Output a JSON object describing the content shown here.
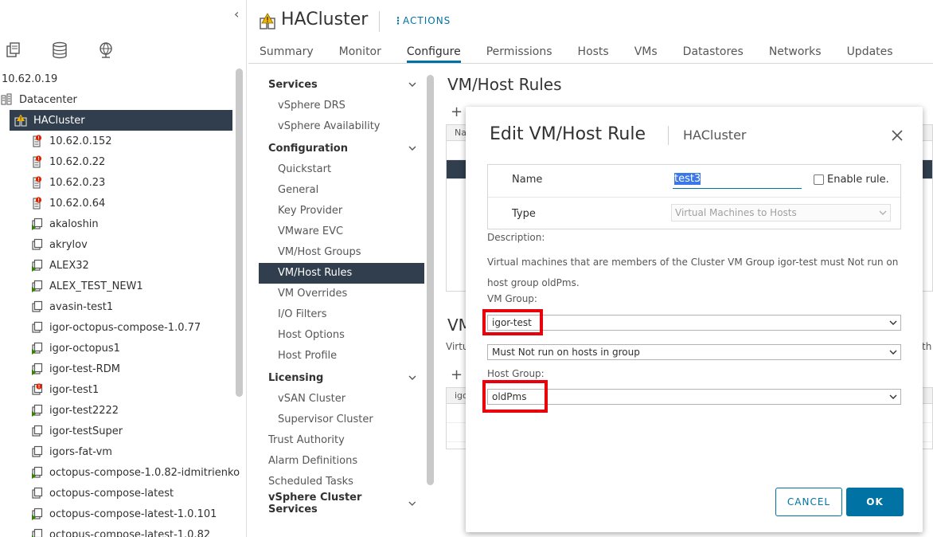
{
  "left_panel": {
    "collapse_glyph": "‹",
    "tab_icons": [
      "hosts-clusters-icon",
      "storage-icon",
      "network-icon"
    ],
    "tree": [
      {
        "label": "10.62.0.19",
        "icon": "none",
        "indent": 0
      },
      {
        "label": "Datacenter",
        "icon": "datacenter-icon",
        "indent": 0
      },
      {
        "label": "HACluster",
        "icon": "cluster-warning-icon",
        "indent": 1,
        "selected": true
      },
      {
        "label": "10.62.0.152",
        "icon": "host-alert-icon",
        "indent": 2
      },
      {
        "label": "10.62.0.22",
        "icon": "host-alert-icon",
        "indent": 2
      },
      {
        "label": "10.62.0.23",
        "icon": "host-alert-icon",
        "indent": 2
      },
      {
        "label": "10.62.0.64",
        "icon": "host-alert-icon",
        "indent": 2
      },
      {
        "label": "akaloshin",
        "icon": "vm-on-icon",
        "indent": 2
      },
      {
        "label": "akrylov",
        "icon": "vm-icon",
        "indent": 2
      },
      {
        "label": "ALEX32",
        "icon": "vm-on-icon",
        "indent": 2
      },
      {
        "label": "ALEX_TEST_NEW1",
        "icon": "vm-on-icon",
        "indent": 2
      },
      {
        "label": "avasin-test1",
        "icon": "vm-icon",
        "indent": 2
      },
      {
        "label": "igor-octopus-compose-1.0.77",
        "icon": "vm-icon",
        "indent": 2
      },
      {
        "label": "igor-octopus1",
        "icon": "vm-on-icon",
        "indent": 2
      },
      {
        "label": "igor-test-RDM",
        "icon": "vm-on-icon",
        "indent": 2
      },
      {
        "label": "igor-test1",
        "icon": "vm-alert-icon",
        "indent": 2
      },
      {
        "label": "igor-test2222",
        "icon": "vm-on-icon",
        "indent": 2
      },
      {
        "label": "igor-testSuper",
        "icon": "vm-icon",
        "indent": 2
      },
      {
        "label": "igors-fat-vm",
        "icon": "vm-icon",
        "indent": 2
      },
      {
        "label": "octopus-compose-1.0.82-idmitrienko",
        "icon": "vm-on-icon",
        "indent": 2
      },
      {
        "label": "octopus-compose-latest",
        "icon": "vm-icon",
        "indent": 2
      },
      {
        "label": "octopus-compose-latest-1.0.101",
        "icon": "vm-on-icon",
        "indent": 2
      },
      {
        "label": "octopus-compose-latest-1.0.82",
        "icon": "vm-on-icon",
        "indent": 2
      }
    ]
  },
  "header": {
    "title": "HACluster",
    "actions_label": "ACTIONS",
    "tabs": [
      "Summary",
      "Monitor",
      "Configure",
      "Permissions",
      "Hosts",
      "VMs",
      "Datastores",
      "Networks",
      "Updates"
    ],
    "active_tab": "Configure"
  },
  "subnav": [
    {
      "type": "section",
      "label": "Services",
      "chevron": true
    },
    {
      "type": "item",
      "label": "vSphere DRS"
    },
    {
      "type": "item",
      "label": "vSphere Availability"
    },
    {
      "type": "section",
      "label": "Configuration",
      "chevron": true
    },
    {
      "type": "item",
      "label": "Quickstart"
    },
    {
      "type": "item",
      "label": "General"
    },
    {
      "type": "item",
      "label": "Key Provider"
    },
    {
      "type": "item",
      "label": "VMware EVC"
    },
    {
      "type": "item",
      "label": "VM/Host Groups"
    },
    {
      "type": "item",
      "label": "VM/Host Rules",
      "selected": true
    },
    {
      "type": "item",
      "label": "VM Overrides"
    },
    {
      "type": "item",
      "label": "I/O Filters"
    },
    {
      "type": "item",
      "label": "Host Options"
    },
    {
      "type": "item",
      "label": "Host Profile"
    },
    {
      "type": "section",
      "label": "Licensing",
      "chevron": true
    },
    {
      "type": "item",
      "label": "vSAN Cluster"
    },
    {
      "type": "item",
      "label": "Supervisor Cluster"
    },
    {
      "type": "top",
      "label": "Trust Authority"
    },
    {
      "type": "top",
      "label": "Alarm Definitions"
    },
    {
      "type": "top",
      "label": "Scheduled Tasks"
    },
    {
      "type": "section",
      "label": "vSphere Cluster Services",
      "chevron": true
    }
  ],
  "content": {
    "title": "VM/Host Rules",
    "table_header_fragment": "Na",
    "lower_title_fragment": "VM",
    "lower_text_fragment": "Virtu",
    "lower_right_fragment": "th",
    "lower_table_header_fragment": "igo"
  },
  "dialog": {
    "title": "Edit VM/Host Rule",
    "subtitle": "HACluster",
    "name_label": "Name",
    "name_value": "test3",
    "enable_label": "Enable rule.",
    "enable_checked": false,
    "type_label": "Type",
    "type_value": "Virtual Machines to Hosts",
    "description_label": "Description:",
    "description_text": "Virtual machines that are members of the Cluster VM Group igor-test must Not run on host group oldPms.",
    "vm_group_label": "VM Group:",
    "vm_group_value": "igor-test",
    "relation_value": "Must Not run on hosts in group",
    "host_group_label": "Host Group:",
    "host_group_value": "oldPms",
    "cancel_label": "CANCEL",
    "ok_label": "OK"
  },
  "colors": {
    "accent": "#0072a3",
    "selection": "#313e4d",
    "highlight_box": "#e8000b",
    "alert": "#e12200",
    "vm_on": "#2f8400"
  }
}
